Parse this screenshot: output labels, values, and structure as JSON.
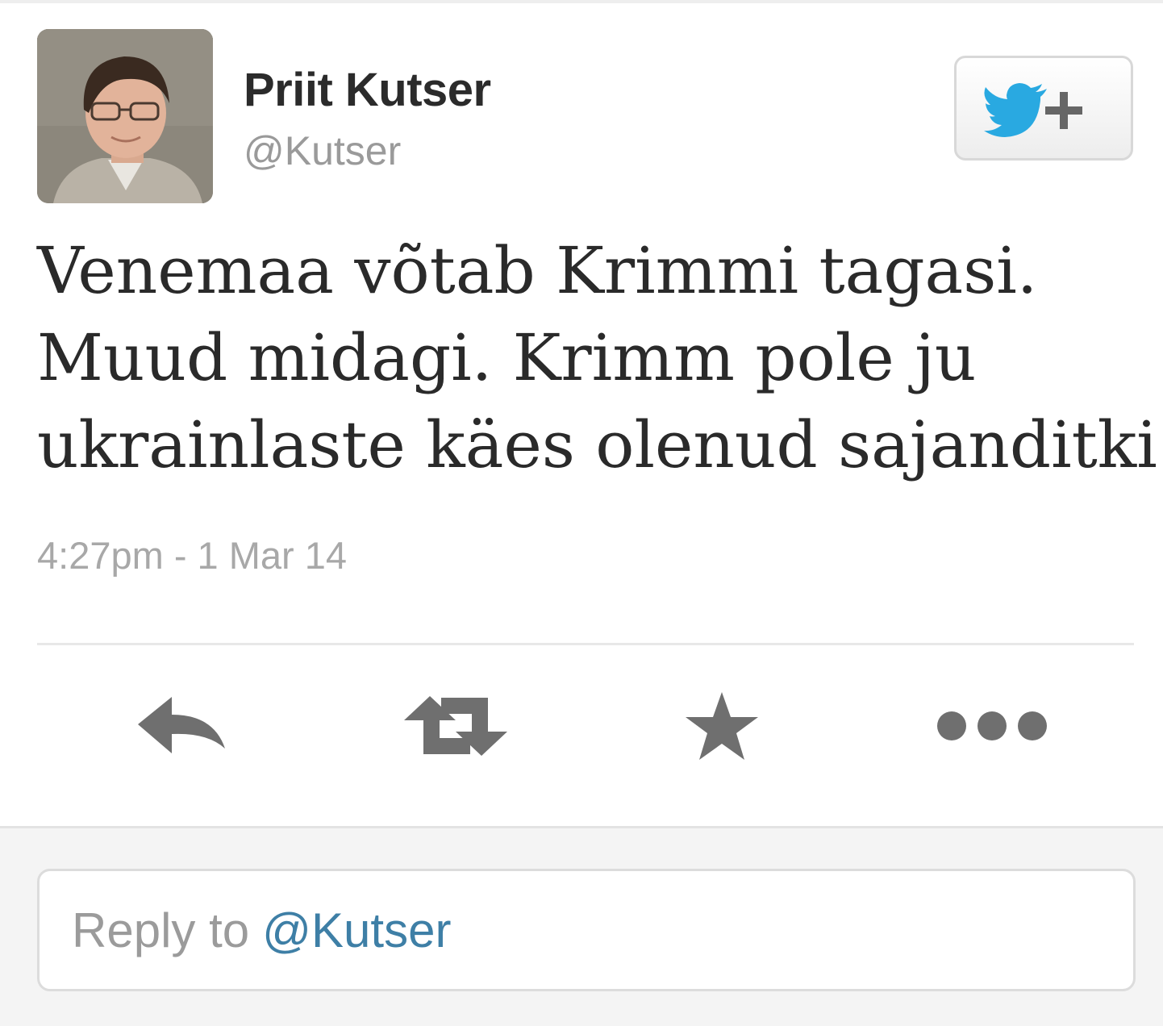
{
  "author": {
    "display_name": "Priit Kutser",
    "handle": "@Kutser"
  },
  "follow_button": {
    "icon": "twitter-bird-plus-icon",
    "bird_color": "#29a9e1"
  },
  "tweet": {
    "text_lines": [
      "Venemaa võtab Krimmi tagasi.",
      "Muud midagi. Krimm pole ju",
      "ukrainlaste käes olenud sajanditki."
    ],
    "timestamp": "4:27pm - 1 Mar 14"
  },
  "actions": [
    {
      "name": "reply",
      "icon": "reply-arrow-icon"
    },
    {
      "name": "retweet",
      "icon": "retweet-icon"
    },
    {
      "name": "favorite",
      "icon": "star-icon"
    },
    {
      "name": "more",
      "icon": "more-dots-icon"
    }
  ],
  "reply_box": {
    "prefix": "Reply to",
    "mention": "@Kutser"
  },
  "colors": {
    "icon_gray": "#6f6f6f",
    "mention_blue": "#3e7fa6"
  }
}
